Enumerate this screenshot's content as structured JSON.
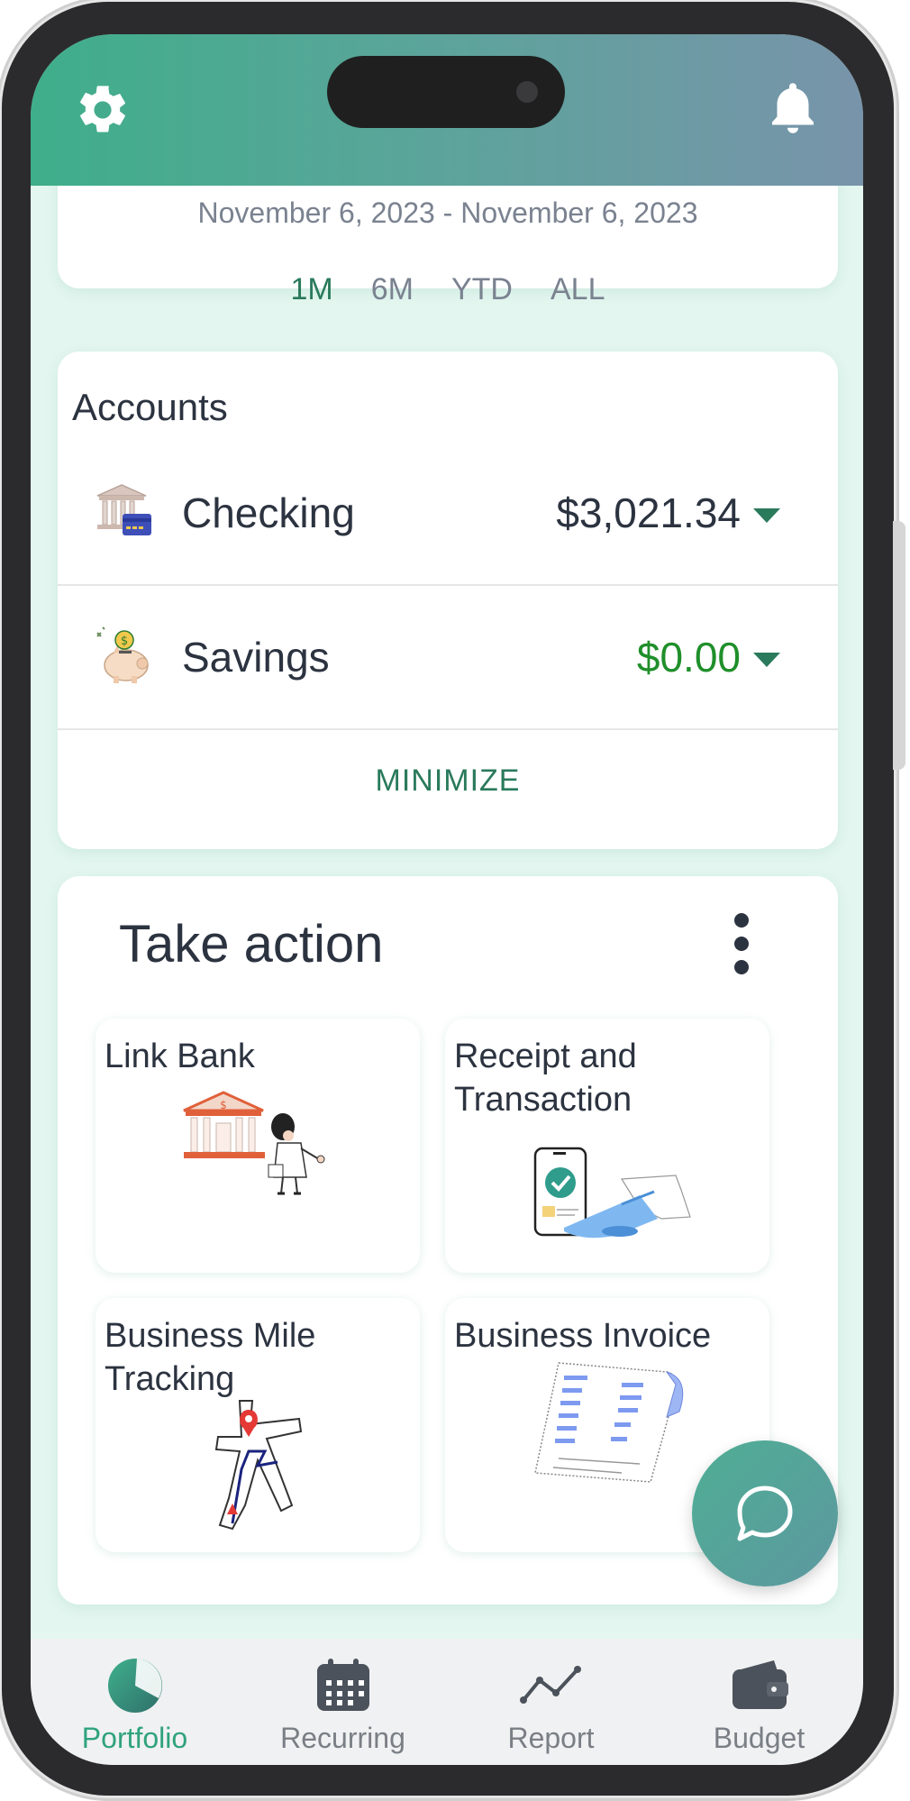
{
  "header": {
    "settings_icon": "gear-icon",
    "notifications_icon": "bell-icon"
  },
  "range": {
    "date_range": "November 6, 2023 - November 6, 2023",
    "tabs": [
      "1M",
      "6M",
      "YTD",
      "ALL"
    ],
    "active_tab": "1M"
  },
  "accounts": {
    "title": "Accounts",
    "items": [
      {
        "name": "Checking",
        "amount": "$3,021.34",
        "icon": "bank-card-icon"
      },
      {
        "name": "Savings",
        "amount": "$0.00",
        "icon": "piggy-bank-icon"
      }
    ],
    "minimize_label": "MINIMIZE"
  },
  "take_action": {
    "title": "Take action",
    "tiles": [
      {
        "label": "Link Bank"
      },
      {
        "label": "Receipt and Transaction"
      },
      {
        "label": "Business Mile Tracking"
      },
      {
        "label": "Business Invoice"
      }
    ]
  },
  "nav": {
    "items": [
      {
        "label": "Portfolio",
        "icon": "pie-chart-icon"
      },
      {
        "label": "Recurring",
        "icon": "calendar-icon"
      },
      {
        "label": "Report",
        "icon": "line-chart-icon"
      },
      {
        "label": "Budget",
        "icon": "wallet-icon"
      }
    ],
    "active": "Portfolio"
  },
  "colors": {
    "accent": "#2fa37c",
    "positive_amount": "#1f8f2a",
    "header_gradient_start": "#3fae8a",
    "header_gradient_end": "#7894aa"
  }
}
